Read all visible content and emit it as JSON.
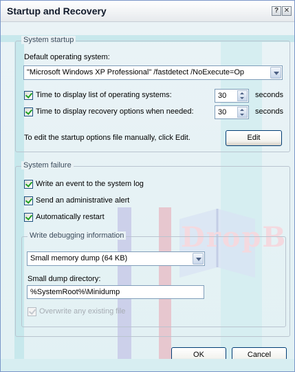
{
  "window": {
    "title": "Startup and Recovery",
    "help_glyph": "?",
    "close_glyph": "✕"
  },
  "watermark": {
    "text": "DropB"
  },
  "startup": {
    "group_label": "System startup",
    "default_os_label": "Default operating system:",
    "default_os_value": "\"Microsoft Windows XP Professional\" /fastdetect /NoExecute=Op",
    "display_list_label": "Time to display list of operating systems:",
    "display_list_value": "30",
    "display_list_checked": true,
    "recovery_label": "Time to display recovery options when needed:",
    "recovery_value": "30",
    "recovery_checked": true,
    "seconds_label": "seconds",
    "edit_hint": "To edit the startup options file manually, click Edit.",
    "edit_button": "Edit"
  },
  "failure": {
    "group_label": "System failure",
    "write_event_label": "Write an event to the system log",
    "write_event_checked": true,
    "send_alert_label": "Send an administrative alert",
    "send_alert_checked": true,
    "auto_restart_label": "Automatically restart",
    "auto_restart_checked": true,
    "debug_group_label": "Write debugging information",
    "dump_type_value": "Small memory dump (64 KB)",
    "dump_dir_label": "Small dump directory:",
    "dump_dir_value": "%SystemRoot%\\Minidump",
    "overwrite_label": "Overwrite any existing file",
    "overwrite_checked": true,
    "overwrite_disabled": true
  },
  "footer": {
    "ok_button": "OK",
    "cancel_button": "Cancel"
  }
}
